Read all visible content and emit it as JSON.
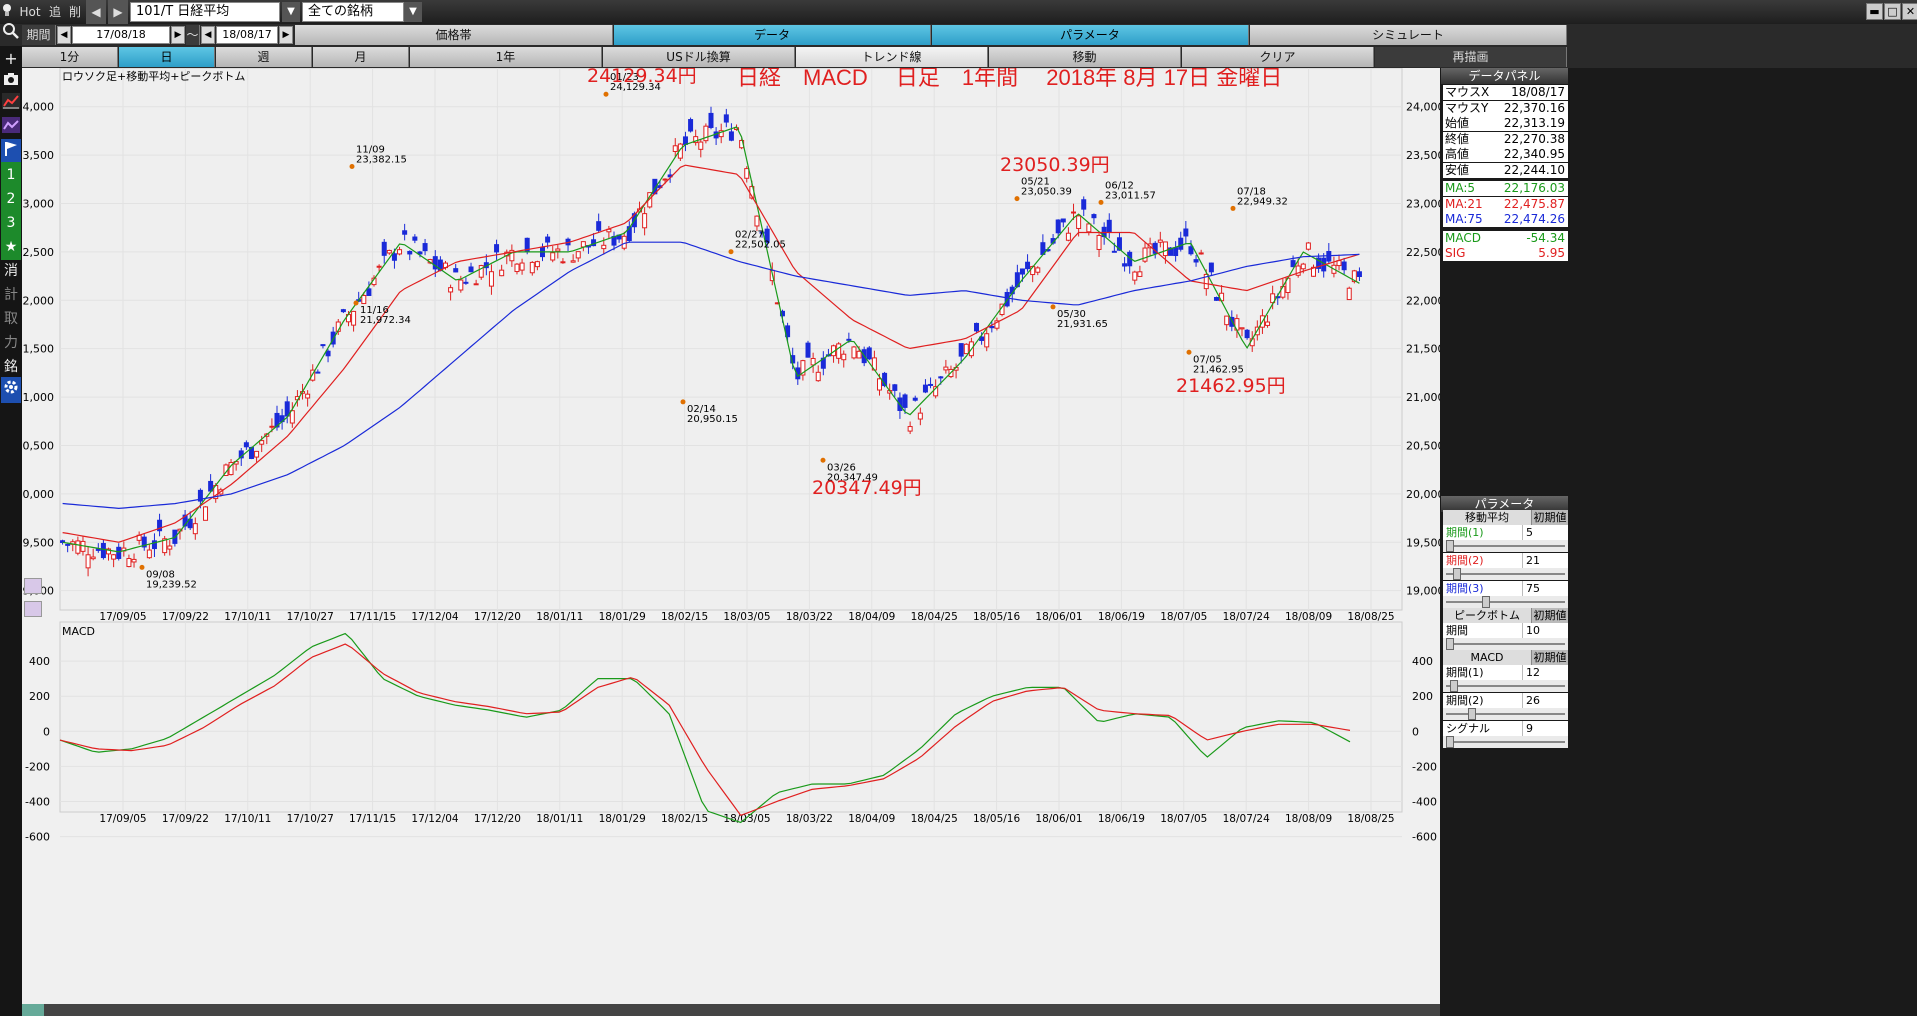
{
  "topbar": {
    "hot": "Hot",
    "add": "追",
    "del": "削",
    "symbol": "101/T 日経平均",
    "list": "全ての銘柄"
  },
  "row1": {
    "period_label": "期間",
    "from": "17/08/18",
    "tilde": "～",
    "to": "18/08/17",
    "tabs": [
      "価格帯",
      "データ",
      "パラメータ",
      "シミュレート"
    ]
  },
  "row2": {
    "tabs": [
      "1分",
      "日",
      "週",
      "月",
      "1年",
      "USドル換算",
      "トレンド線",
      "移動",
      "クリア",
      "再描画"
    ]
  },
  "left_toolbar": {
    "icons": [
      "search-icon",
      "crosshair-icon",
      "camera-icon",
      "line-chart-icon",
      "chart-purple-icon",
      "flag-icon"
    ],
    "buttons": [
      "1",
      "2",
      "3",
      "★",
      "消",
      "計",
      "取",
      "力",
      "銘"
    ]
  },
  "chart": {
    "legend": "ロウソク足+移動平均+ピークボトム",
    "title": "日経　MACD　 日足　1年間　 2018年 8月 17日 金曜日",
    "macd_label": "MACD",
    "annotations_big": [
      "24129.34円",
      "23050.39円",
      "21462.95円",
      "20347.49円"
    ],
    "peaks": [
      {
        "date": "11/09",
        "value": "23,382.15"
      },
      {
        "date": "11/16",
        "value": "21,972.34"
      },
      {
        "date": "09/08",
        "value": "19,239.52"
      },
      {
        "date": "01/23",
        "value": "24,129.34"
      },
      {
        "date": "02/14",
        "value": "20,950.15"
      },
      {
        "date": "02/27",
        "value": "22,502.05"
      },
      {
        "date": "03/26",
        "value": "20,347.49"
      },
      {
        "date": "05/21",
        "value": "23,050.39"
      },
      {
        "date": "05/30",
        "value": "21,931.65"
      },
      {
        "date": "06/12",
        "value": "23,011.57"
      },
      {
        "date": "07/05",
        "value": "21,462.95"
      },
      {
        "date": "07/18",
        "value": "22,949.32"
      }
    ],
    "x_ticks": [
      "17/09/05",
      "17/09/22",
      "17/10/11",
      "17/10/27",
      "17/11/15",
      "17/12/04",
      "17/12/20",
      "18/01/11",
      "18/01/29",
      "18/02/15",
      "18/03/05",
      "18/03/22",
      "18/04/09",
      "18/04/25",
      "18/05/16",
      "18/06/01",
      "18/06/19",
      "18/07/05",
      "18/07/24",
      "18/08/09",
      "18/08/25"
    ],
    "y_ticks": [
      "24,000",
      "23,500",
      "23,000",
      "22,500",
      "22,000",
      "21,500",
      "21,000",
      "20,500",
      "20,000",
      "19,500",
      "19,000"
    ],
    "macd_ticks": [
      "400",
      "200",
      "0",
      "-200",
      "-400",
      "-600"
    ],
    "colors": {
      "up": "#e02020",
      "down": "#1a2ad8",
      "ma5": "#1a9a1a",
      "ma21": "#e02020",
      "ma75": "#1a2ad8",
      "peak": "#e07000"
    }
  },
  "chart_data": {
    "type": "line",
    "title": "日経　MACD　 日足　1年間　 2018年 8月 17日 金曜日",
    "series": [
      {
        "name": "MA:5",
        "values": [
          19500,
          19400,
          19550,
          20300,
          20800,
          21800,
          22600,
          22200,
          22500,
          22500,
          22700,
          23600,
          23800,
          21200,
          21600,
          20800,
          21400,
          22200,
          22900,
          22400,
          22600,
          21500,
          22500,
          22176
        ]
      },
      {
        "name": "MA:21",
        "values": [
          19600,
          19500,
          19700,
          20100,
          20600,
          21300,
          22100,
          22400,
          22500,
          22600,
          22800,
          23400,
          23300,
          22300,
          21800,
          21500,
          21600,
          21900,
          22700,
          22700,
          22200,
          22100,
          22300,
          22476
        ]
      },
      {
        "name": "MA:75",
        "values": [
          19900,
          19850,
          19900,
          20000,
          20200,
          20500,
          20900,
          21400,
          21900,
          22300,
          22600,
          22600,
          22400,
          22250,
          22150,
          22050,
          22100,
          22000,
          21950,
          22100,
          22200,
          22350,
          22450,
          22474
        ]
      }
    ],
    "ylim": [
      18800,
      24400
    ],
    "x_range": [
      "17/08/18",
      "18/08/17"
    ]
  },
  "panel": {
    "data_header": "データパネル",
    "rows": [
      {
        "k": "マウスX",
        "v": "18/08/17",
        "c": "#000"
      },
      {
        "k": "マウスY",
        "v": "22,370.16",
        "c": "#000"
      },
      {
        "k": "始値",
        "v": "22,313.19",
        "c": "#000"
      },
      {
        "k": "終値",
        "v": "22,270.38",
        "c": "#000"
      },
      {
        "k": "高値",
        "v": "22,340.95",
        "c": "#000"
      },
      {
        "k": "安値",
        "v": "22,244.10",
        "c": "#000"
      },
      {
        "k": "MA:5",
        "v": "22,176.03",
        "c": "#1a9a1a"
      },
      {
        "k": "MA:21",
        "v": "22,475.87",
        "c": "#e02020"
      },
      {
        "k": "MA:75",
        "v": "22,474.26",
        "c": "#1a2ad8"
      },
      {
        "k": "MACD",
        "v": "-54.34",
        "c": "#1a9a1a"
      },
      {
        "k": "SIG",
        "v": "5.95",
        "c": "#e02020"
      }
    ],
    "param_header": "パラメータ",
    "ma_header": "移動平均",
    "init": "初期値",
    "ma_rows": [
      {
        "k": "期間(1)",
        "v": "5",
        "c": "#1a9a1a",
        "knob": 0.0
      },
      {
        "k": "期間(2)",
        "v": "21",
        "c": "#e02020",
        "knob": 0.06
      },
      {
        "k": "期間(3)",
        "v": "75",
        "c": "#1a2ad8",
        "knob": 0.33
      }
    ],
    "pb_header": "ピークボトム",
    "pb_rows": [
      {
        "k": "期間",
        "v": "10",
        "c": "#000",
        "knob": 0.0
      }
    ],
    "macd_header": "MACD",
    "macd_rows": [
      {
        "k": "期間(1)",
        "v": "12",
        "c": "#000",
        "knob": 0.04
      },
      {
        "k": "期間(2)",
        "v": "26",
        "c": "#000",
        "knob": 0.2
      },
      {
        "k": "シグナル",
        "v": "9",
        "c": "#000",
        "knob": 0.0
      }
    ]
  }
}
